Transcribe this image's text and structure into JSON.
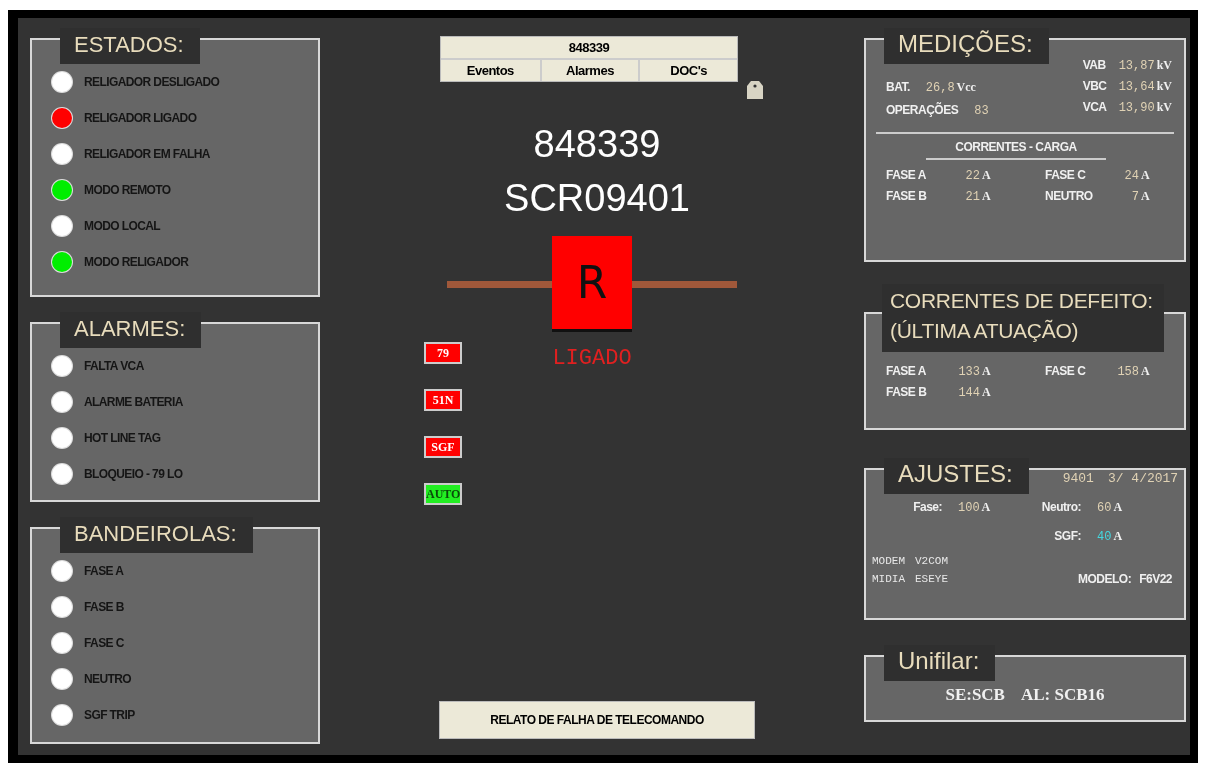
{
  "estados": {
    "title": "ESTADOS:",
    "items": [
      {
        "label": "RELIGADOR DESLIGADO",
        "color": "#ffffff"
      },
      {
        "label": "RELIGADOR LIGADO",
        "color": "#ff0000"
      },
      {
        "label": "RELIGADOR EM FALHA",
        "color": "#ffffff"
      },
      {
        "label": "MODO REMOTO",
        "color": "#00ee00"
      },
      {
        "label": "MODO LOCAL",
        "color": "#ffffff"
      },
      {
        "label": "MODO RELIGADOR",
        "color": "#00ee00"
      }
    ]
  },
  "alarmes": {
    "title": "ALARMES:",
    "items": [
      {
        "label": "FALTA VCA",
        "color": "#ffffff"
      },
      {
        "label": "ALARME BATERIA",
        "color": "#ffffff"
      },
      {
        "label": "HOT LINE TAG",
        "color": "#ffffff"
      },
      {
        "label": "BLOQUEIO - 79 LO",
        "color": "#ffffff"
      }
    ]
  },
  "bandeirolas": {
    "title": "BANDEIROLAS:",
    "items": [
      {
        "label": "FASE A",
        "color": "#ffffff"
      },
      {
        "label": "FASE B",
        "color": "#ffffff"
      },
      {
        "label": "FASE C",
        "color": "#ffffff"
      },
      {
        "label": "NEUTRO",
        "color": "#ffffff"
      },
      {
        "label": "SGF TRIP",
        "color": "#ffffff"
      }
    ]
  },
  "header": {
    "title": "848339",
    "tabs": [
      {
        "label": "Eventos"
      },
      {
        "label": "Alarmes"
      },
      {
        "label": "DOC's"
      }
    ]
  },
  "equipment": {
    "id": "848339",
    "name": "SCR09401",
    "symbol": "R",
    "color": "#ff0000",
    "status": "LIGADO"
  },
  "flags": [
    {
      "label": "79",
      "color": "#ff0000"
    },
    {
      "label": "51N",
      "color": "#ff0000"
    },
    {
      "label": "SGF",
      "color": "#ff0000"
    },
    {
      "label": "AUTO",
      "color": "#22ee22"
    }
  ],
  "report_button": "RELATO DE FALHA DE TELECOMANDO",
  "medicoes": {
    "title": "MEDIÇÕES:",
    "battery": {
      "label": "BAT.",
      "value": "26,8",
      "unit": "Vcc"
    },
    "operations": {
      "label": "OPERAÇÕES",
      "value": "83"
    },
    "voltages": [
      {
        "label": "VAB",
        "value": "13,87",
        "unit": "kV"
      },
      {
        "label": "VBC",
        "value": "13,64",
        "unit": "kV"
      },
      {
        "label": "VCA",
        "value": "13,90",
        "unit": "kV"
      }
    ],
    "subtitle": "CORRENTES - CARGA",
    "currents": [
      {
        "label": "FASE A",
        "value": "22",
        "unit": "A"
      },
      {
        "label": "FASE C",
        "value": "24",
        "unit": "A"
      },
      {
        "label": "FASE B",
        "value": "21",
        "unit": "A"
      },
      {
        "label": "NEUTRO",
        "value": "7",
        "unit": "A"
      }
    ]
  },
  "defeito": {
    "title": [
      "CORRENTES DE DEFEITO:",
      "(ÚLTIMA ATUAÇÃO)"
    ],
    "currents": [
      {
        "label": "FASE A",
        "value": "133",
        "unit": "A"
      },
      {
        "label": "FASE C",
        "value": "158",
        "unit": "A"
      },
      {
        "label": "FASE B",
        "value": "144",
        "unit": "A"
      }
    ]
  },
  "ajustes": {
    "title": "AJUSTES:",
    "code": "9401",
    "date": "3/ 4/2017",
    "settings": [
      {
        "label": "Fase:",
        "value": "100",
        "unit": "A",
        "color": "#e0d2b4"
      },
      {
        "label": "Neutro:",
        "value": "60",
        "unit": "A",
        "color": "#e0d2b4"
      },
      {
        "label": "SGF:",
        "value": "40",
        "unit": "A",
        "color": "#44d8e0"
      }
    ],
    "info": [
      {
        "label": "MODEM",
        "value": "V2COM"
      },
      {
        "label": "MIDIA",
        "value": "ESEYE"
      }
    ],
    "model": {
      "label": "MODELO:",
      "value": "F6V22"
    }
  },
  "unifilar": {
    "title": "Unifilar:",
    "texts": [
      "SE:SCB",
      "AL: SCB16"
    ]
  }
}
